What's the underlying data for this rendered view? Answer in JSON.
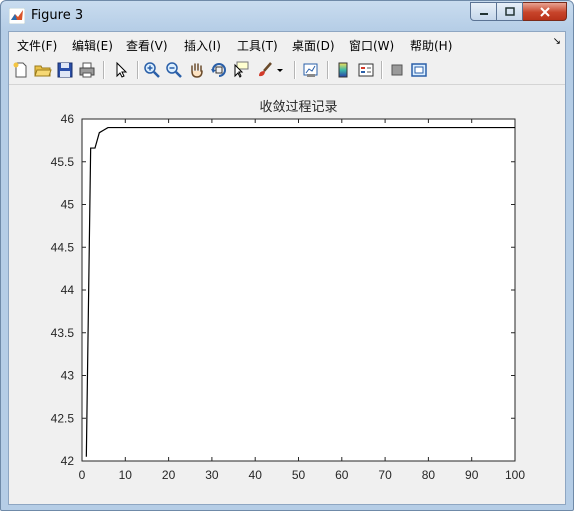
{
  "window": {
    "title": "Figure 3"
  },
  "menu": [
    {
      "label": "文件(F)",
      "name": "menu-file"
    },
    {
      "label": "编辑(E)",
      "name": "menu-edit"
    },
    {
      "label": "查看(V)",
      "name": "menu-view"
    },
    {
      "label": "插入(I)",
      "name": "menu-insert"
    },
    {
      "label": "工具(T)",
      "name": "menu-tools"
    },
    {
      "label": "桌面(D)",
      "name": "menu-desktop"
    },
    {
      "label": "窗口(W)",
      "name": "menu-window"
    },
    {
      "label": "帮助(H)",
      "name": "menu-help"
    }
  ],
  "toolbar": [
    {
      "name": "new-figure-icon"
    },
    {
      "name": "open-file-icon"
    },
    {
      "name": "save-icon"
    },
    {
      "name": "print-icon"
    },
    {
      "name": "edit-plot-arrow-icon"
    },
    {
      "name": "zoom-in-icon"
    },
    {
      "name": "zoom-out-icon"
    },
    {
      "name": "pan-hand-icon"
    },
    {
      "name": "rotate-3d-icon"
    },
    {
      "name": "data-cursor-icon"
    },
    {
      "name": "brush-icon"
    },
    {
      "name": "brush-dropdown-icon"
    },
    {
      "name": "link-plot-icon"
    },
    {
      "name": "insert-colorbar-icon"
    },
    {
      "name": "insert-legend-icon"
    },
    {
      "name": "hide-plot-tools-icon"
    },
    {
      "name": "show-plot-tools-icon"
    }
  ],
  "chart_data": {
    "type": "line",
    "title": "收敛过程记录",
    "xlabel": "",
    "ylabel": "",
    "xlim": [
      0,
      100
    ],
    "ylim": [
      42,
      46
    ],
    "xticks": [
      0,
      10,
      20,
      30,
      40,
      50,
      60,
      70,
      80,
      90,
      100
    ],
    "yticks": [
      42,
      42.5,
      43,
      43.5,
      44,
      44.5,
      45,
      45.5,
      46
    ],
    "grid": false,
    "series": [
      {
        "color": "#000000",
        "x": [
          1,
          2,
          3,
          4,
          5,
          6,
          7,
          100
        ],
        "y": [
          42.05,
          45.66,
          45.66,
          45.84,
          45.87,
          45.9,
          45.9,
          45.9
        ]
      }
    ]
  }
}
